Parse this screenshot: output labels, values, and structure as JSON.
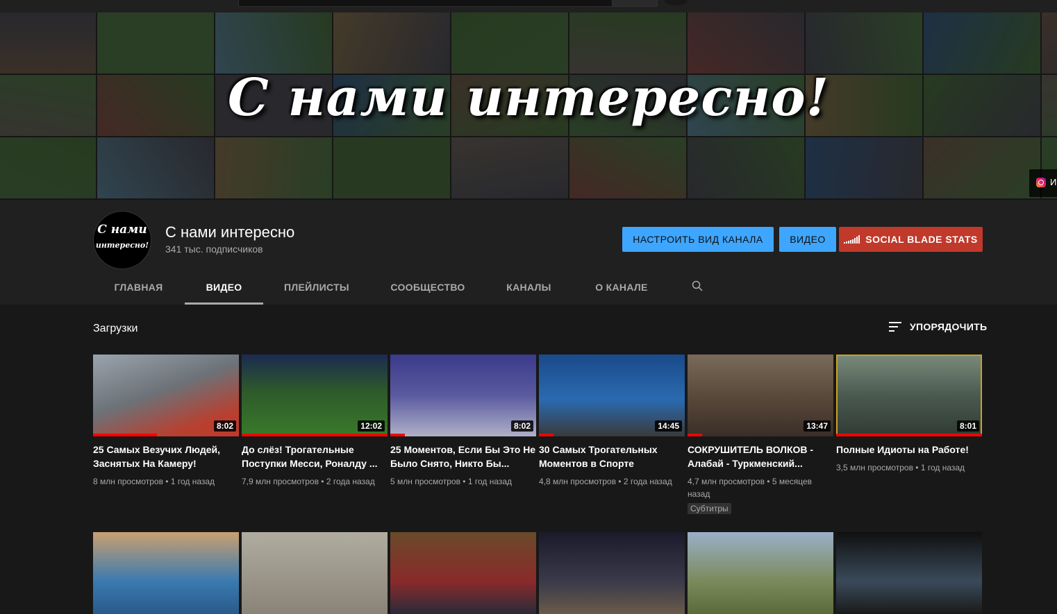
{
  "banner": {
    "title": "С нами интересно!",
    "link_label": "И"
  },
  "channel": {
    "avatar_line1": "С нами",
    "avatar_line2": "интересно!",
    "name": "С нами интересно",
    "subscribers": "341 тыс. подписчиков",
    "buttons": {
      "customize": "НАСТРОИТЬ ВИД КАНАЛА",
      "video": "ВИДЕО",
      "social_blade": "SOCIAL BLADE STATS"
    }
  },
  "tabs": [
    {
      "label": "ГЛАВНАЯ"
    },
    {
      "label": "ВИДЕО",
      "active": true
    },
    {
      "label": "ПЛЕЙЛИСТЫ"
    },
    {
      "label": "СООБЩЕСТВО"
    },
    {
      "label": "КАНАЛЫ"
    },
    {
      "label": "О КАНАЛЕ"
    }
  ],
  "section": {
    "title": "Загрузки",
    "sort_label": "УПОРЯДОЧИТЬ"
  },
  "videos": [
    {
      "title": "25 Самых Везучих Людей, Заснятых На Камеру!",
      "views": "8 млн просмотров",
      "age": "1 год назад",
      "duration": "8:02",
      "watched": 0.44
    },
    {
      "title": "До слёз! Трогательные Поступки Месси, Роналду ...",
      "views": "7,9 млн просмотров",
      "age": "2 года назад",
      "duration": "12:02",
      "watched": 1.0
    },
    {
      "title": "25 Моментов, Если Бы Это Не Было Снято, Никто Бы...",
      "views": "5 млн просмотров",
      "age": "1 год назад",
      "duration": "8:02",
      "watched": 0.1
    },
    {
      "title": "30 Самых Трогательных Моментов в Спорте",
      "views": "4,8 млн просмотров",
      "age": "2 года назад",
      "duration": "14:45",
      "watched": 0.1
    },
    {
      "title": "СОКРУШИТЕЛЬ ВОЛКОВ - Алабай - Туркменский...",
      "views": "4,7 млн просмотров",
      "age": "5 месяцев назад",
      "duration": "13:47",
      "watched": 0.1,
      "badge": "Субтитры"
    },
    {
      "title": "Полные Идиоты на Работе!",
      "views": "3,5 млн просмотров",
      "age": "1 год назад",
      "duration": "8:01",
      "watched": 1.0
    }
  ]
}
